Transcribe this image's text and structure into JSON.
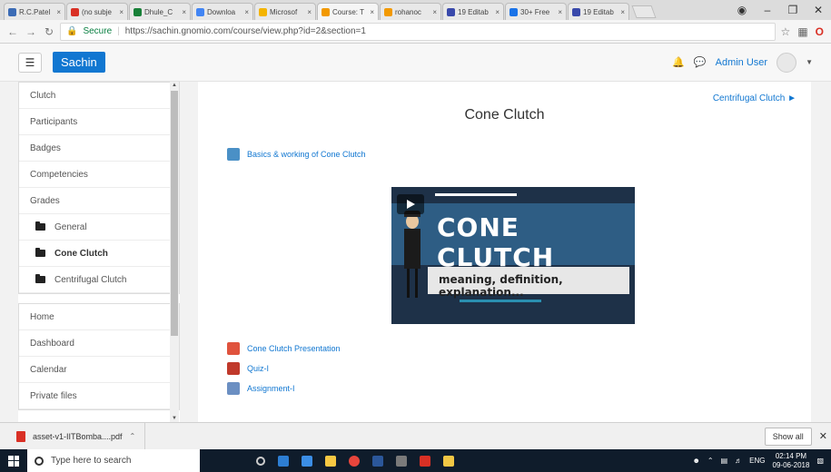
{
  "browser": {
    "tabs": [
      {
        "label": "R.C.Patel",
        "fav": "#3b6bb5",
        "active": false
      },
      {
        "label": "(no subje",
        "fav": "#d93025",
        "active": false
      },
      {
        "label": "Dhule_C",
        "fav": "#188038",
        "active": false
      },
      {
        "label": "Downloa",
        "fav": "#4285f4",
        "active": false
      },
      {
        "label": "Microsof",
        "fav": "#f4b400",
        "active": false
      },
      {
        "label": "Course: T",
        "fav": "#f29900",
        "active": true
      },
      {
        "label": "rohanoc",
        "fav": "#f29900",
        "active": false
      },
      {
        "label": "19 Editab",
        "fav": "#3949ab",
        "active": false
      },
      {
        "label": "30+ Free",
        "fav": "#1a73e8",
        "active": false
      },
      {
        "label": "19 Editab",
        "fav": "#3949ab",
        "active": false
      }
    ],
    "secure_label": "Secure",
    "url": "https://sachin.gnomio.com/course/view.php?id=2&section=1"
  },
  "navbar": {
    "brand": "Sachin",
    "user_name": "Admin User"
  },
  "drawer": {
    "course_items": [
      {
        "label": "Clutch",
        "type": "plain"
      },
      {
        "label": "Participants",
        "type": "plain"
      },
      {
        "label": "Badges",
        "type": "plain"
      },
      {
        "label": "Competencies",
        "type": "plain"
      },
      {
        "label": "Grades",
        "type": "plain"
      },
      {
        "label": "General",
        "type": "folder"
      },
      {
        "label": "Cone Clutch",
        "type": "folder-active"
      },
      {
        "label": "Centrifugal Clutch",
        "type": "folder"
      }
    ],
    "site_items": [
      {
        "label": "Home"
      },
      {
        "label": "Dashboard"
      },
      {
        "label": "Calendar"
      },
      {
        "label": "Private files"
      }
    ]
  },
  "main": {
    "next_section": "Centrifugal Clutch ►",
    "title": "Cone Clutch",
    "activities": [
      {
        "label": "Basics & working of Cone Clutch",
        "icon_color": "#4a90c6"
      },
      {
        "label": "Cone Clutch Presentation",
        "icon_color": "#e0533d"
      },
      {
        "label": "Quiz-I",
        "icon_color": "#c0392b"
      },
      {
        "label": "Assignment-I",
        "icon_color": "#6b8fc2"
      }
    ],
    "video": {
      "title": "CONE CLUTCH",
      "subtitle": "meaning, definition, explanation..."
    }
  },
  "downloads": {
    "file": "asset-v1-IITBomba....pdf",
    "show_all": "Show all"
  },
  "taskbar": {
    "search_placeholder": "Type here to search",
    "lang": "ENG",
    "time": "02:14 PM",
    "date": "09-06-2018"
  }
}
